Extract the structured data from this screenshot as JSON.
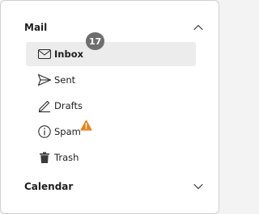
{
  "sections": {
    "mail": {
      "title": "Mail",
      "expanded": true,
      "chevron_icon": "chevron-up-icon"
    },
    "calendar": {
      "title": "Calendar",
      "expanded": false,
      "chevron_icon": "chevron-down-icon"
    }
  },
  "mail_items": [
    {
      "label": "Inbox",
      "icon": "envelope-icon",
      "selected": true,
      "badge": "17"
    },
    {
      "label": "Sent",
      "icon": "send-icon",
      "selected": false
    },
    {
      "label": "Drafts",
      "icon": "pencil-icon",
      "selected": false
    },
    {
      "label": "Spam",
      "icon": "info-icon",
      "selected": false,
      "alert_icon": "warning-icon"
    },
    {
      "label": "Trash",
      "icon": "trash-icon",
      "selected": false
    }
  ],
  "colors": {
    "selected_background": "#ececec",
    "badge": "#6e6e6e",
    "warning": "#e8821a"
  }
}
